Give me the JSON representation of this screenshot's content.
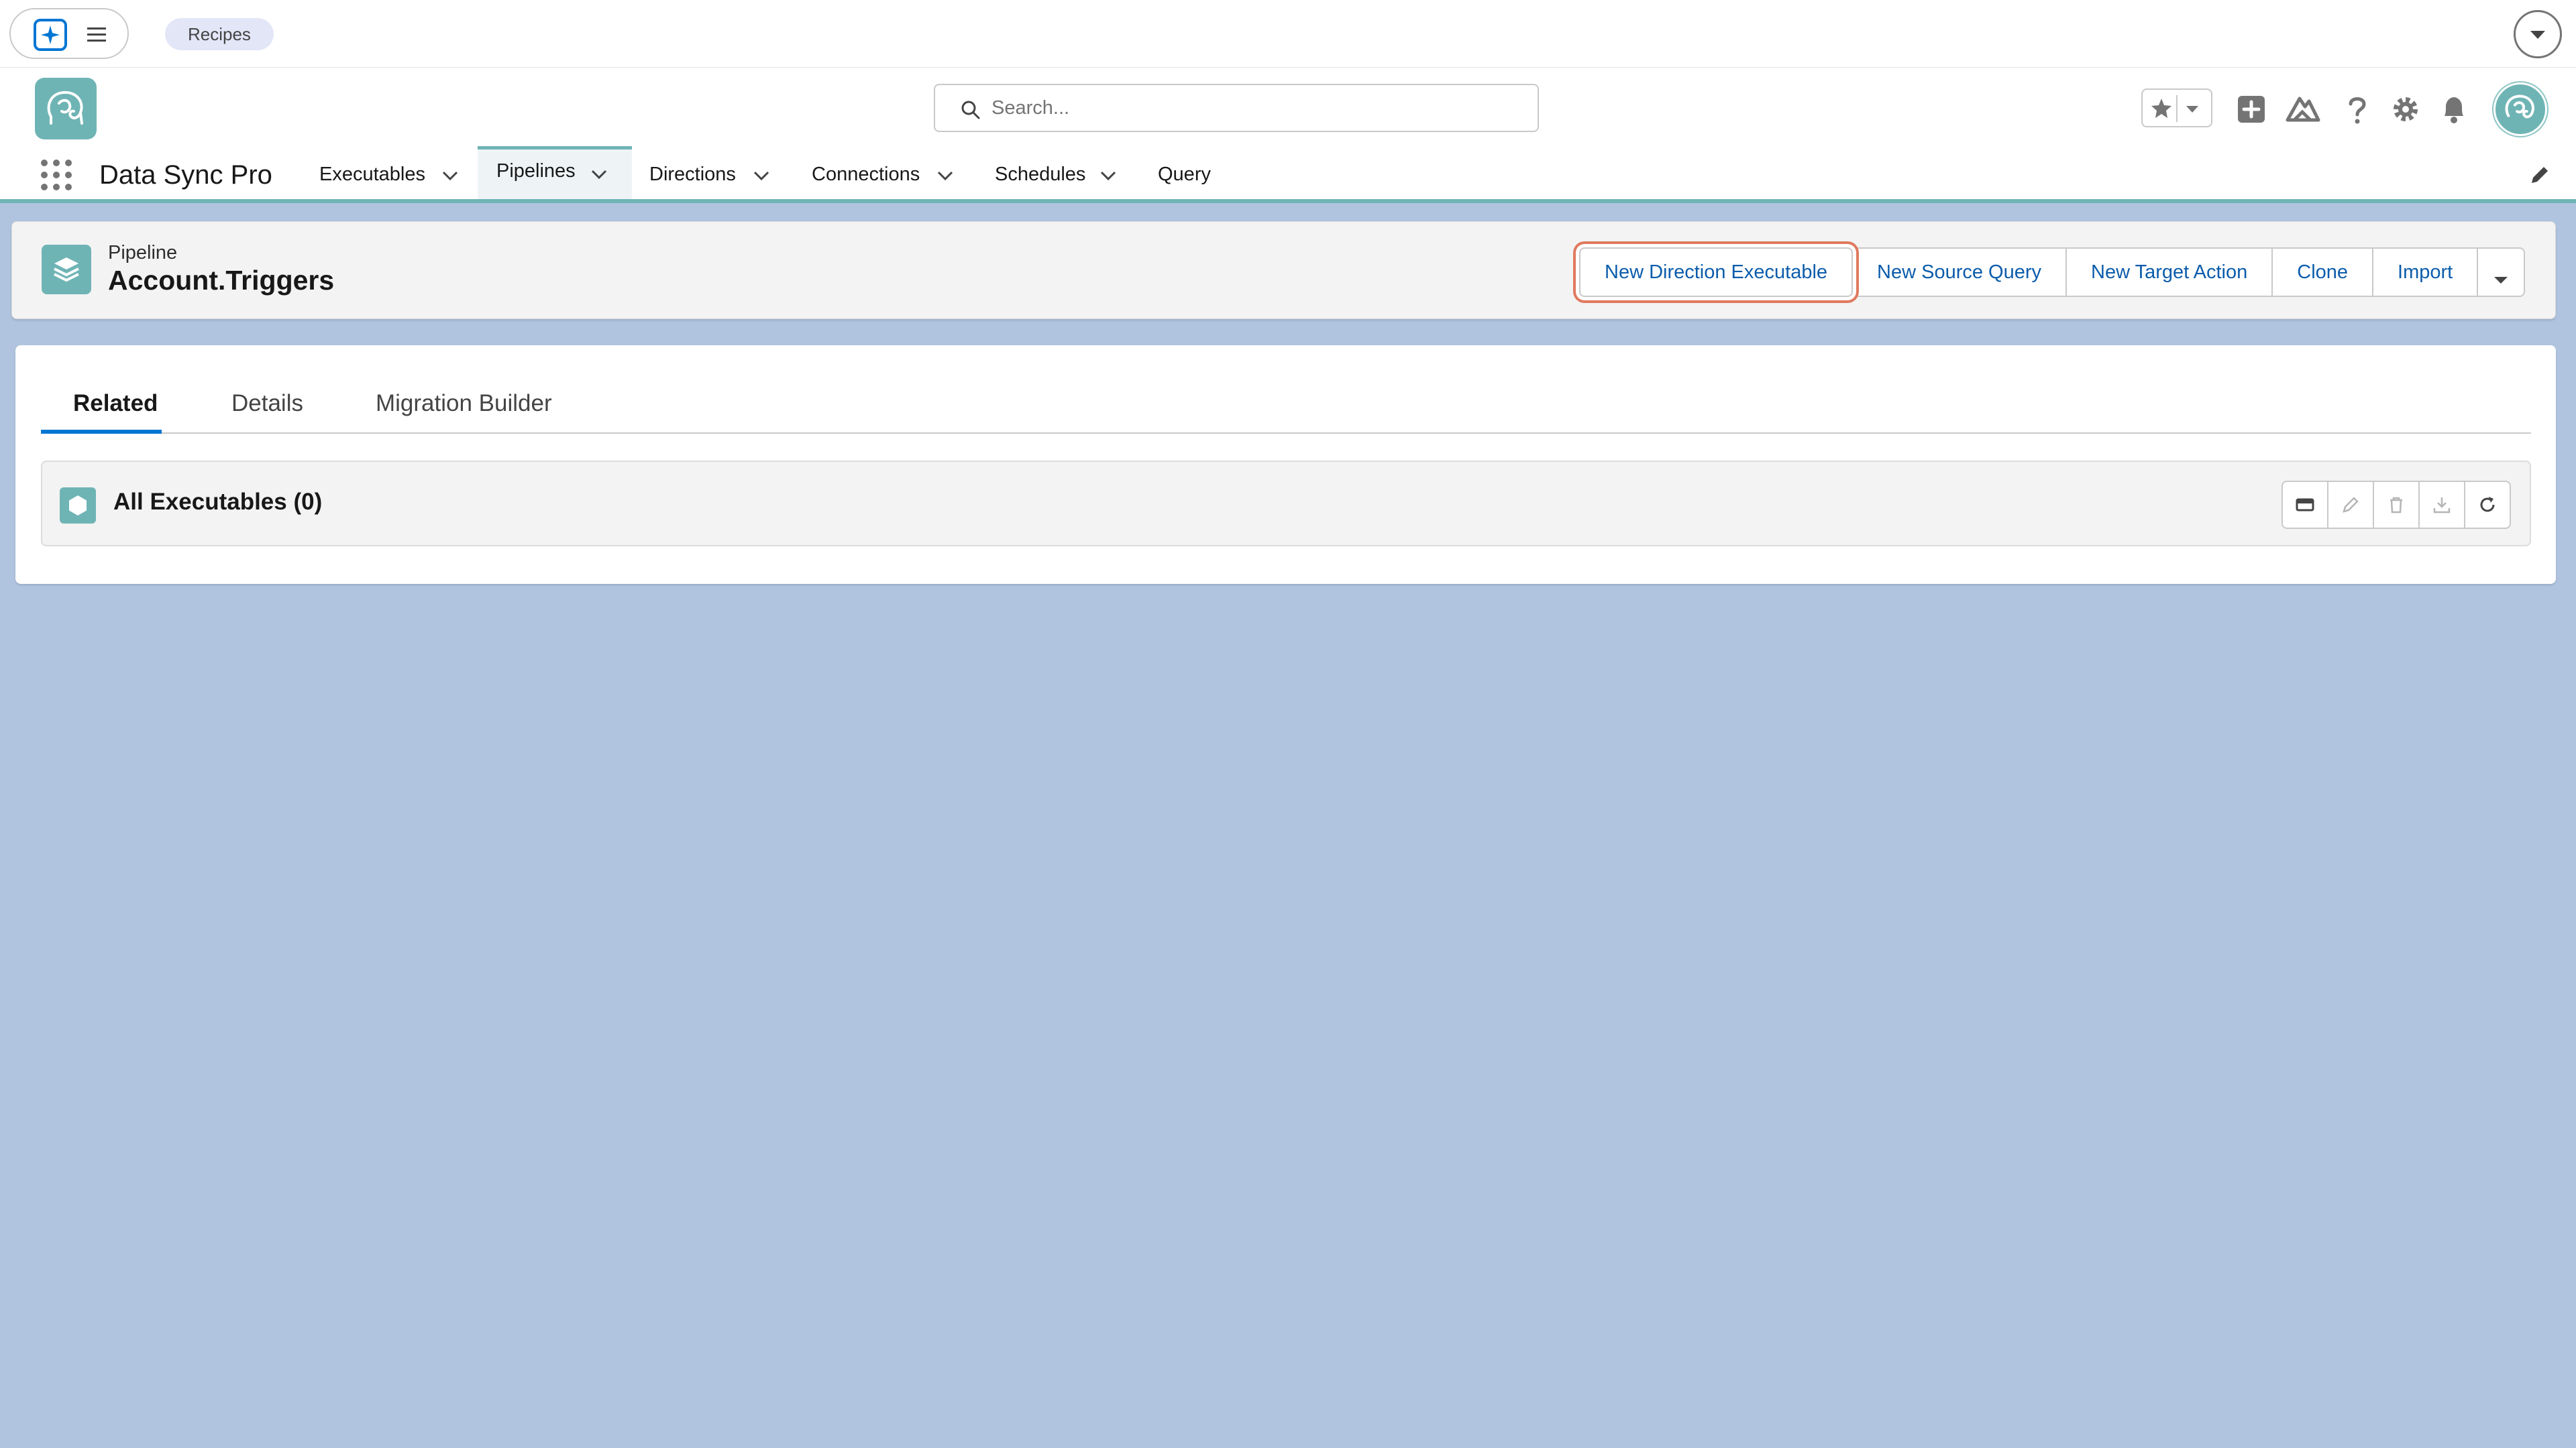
{
  "utility_bar": {
    "agent_icon": "sparkle-icon",
    "menu_icon": "hamburger-icon",
    "recipes_label": "Recipes",
    "dropdown_icon": "chevron-down-icon"
  },
  "header": {
    "logo_icon": "elephant-logo",
    "search": {
      "placeholder": "Search...",
      "value": ""
    },
    "icons": [
      "star-icon",
      "caret-down-icon",
      "add-icon",
      "trailhead-icon",
      "help-icon",
      "gear-icon",
      "bell-icon",
      "avatar"
    ]
  },
  "nav": {
    "app_name": "Data Sync Pro",
    "items": [
      {
        "label": "Executables",
        "has_menu": true
      },
      {
        "label": "Pipelines",
        "has_menu": true,
        "active": true
      },
      {
        "label": "Directions",
        "has_menu": true
      },
      {
        "label": "Connections",
        "has_menu": true
      },
      {
        "label": "Schedules",
        "has_menu": true
      },
      {
        "label": "Query",
        "has_menu": false
      }
    ]
  },
  "record": {
    "type_label": "Pipeline",
    "title": "Account.Triggers",
    "actions": [
      {
        "label": "New Direction Executable",
        "highlighted": true
      },
      {
        "label": "New Source Query"
      },
      {
        "label": "New Target Action"
      },
      {
        "label": "Clone"
      },
      {
        "label": "Import"
      }
    ]
  },
  "tabs": [
    {
      "label": "Related",
      "active": true
    },
    {
      "label": "Details"
    },
    {
      "label": "Migration Builder"
    }
  ],
  "related_list": {
    "title": "All Executables (0)",
    "actions": [
      "card-view-icon",
      "edit-icon",
      "delete-icon",
      "download-icon",
      "refresh-icon"
    ]
  },
  "colors": {
    "brand": "#6fb4b5",
    "link": "#0b5cab",
    "tab_active": "#0176d3",
    "highlight": "#e07a5f",
    "background": "#b0c4df"
  }
}
